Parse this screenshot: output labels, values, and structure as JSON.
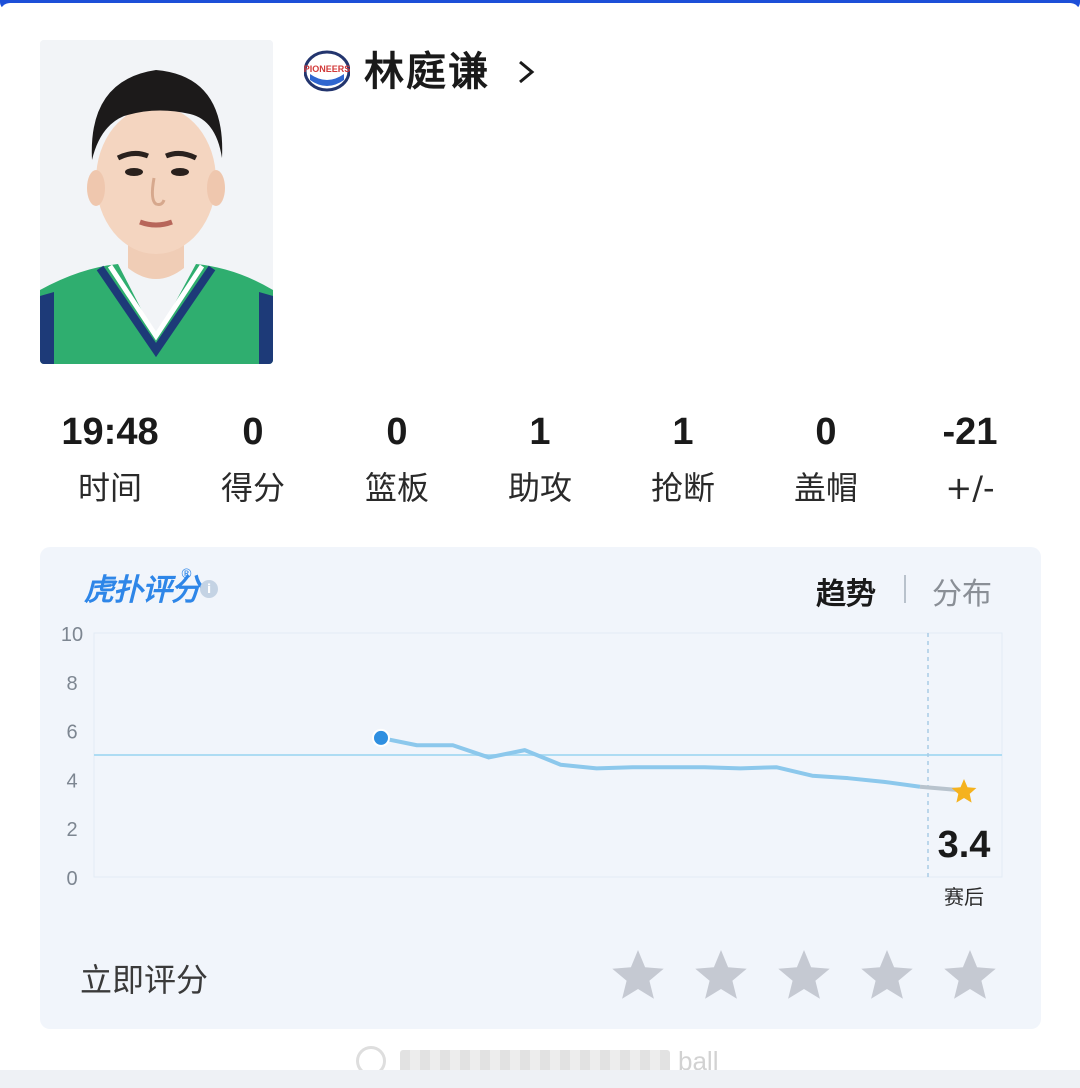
{
  "player": {
    "name": "林庭谦",
    "team_logo_text": "PIONEERS"
  },
  "stats": [
    {
      "value": "19:48",
      "label": "时间"
    },
    {
      "value": "0",
      "label": "得分"
    },
    {
      "value": "0",
      "label": "篮板"
    },
    {
      "value": "1",
      "label": "助攻"
    },
    {
      "value": "1",
      "label": "抢断"
    },
    {
      "value": "0",
      "label": "盖帽"
    },
    {
      "value": "-21",
      "label": "+/-"
    }
  ],
  "rating": {
    "brand": "虎扑评分",
    "brand_mark": "®",
    "info_icon": "i",
    "tabs": {
      "active": "趋势",
      "inactive": "分布"
    },
    "final_score": "3.4",
    "final_label": "赛后",
    "rate_now_label": "立即评分",
    "rate_star_count": 5,
    "colors": {
      "line": "#8cc8ec",
      "start_dot": "#2f8fe0",
      "star": "#f5b21e",
      "empty_star": "#c5c9d2",
      "reference_line": "#aedcf3"
    }
  },
  "chart_data": {
    "type": "line",
    "y_ticks": [
      "10",
      "8",
      "6",
      "4",
      "2",
      "0"
    ],
    "ylim": [
      0,
      10
    ],
    "reference_y": 5,
    "grid": false,
    "series": [
      {
        "values": [
          5.7,
          5.4,
          5.4,
          4.9,
          5.2,
          4.6,
          4.45,
          4.5,
          4.5,
          4.5,
          4.45,
          4.5,
          4.15,
          4.05,
          3.9,
          3.7
        ]
      }
    ],
    "final_value": 3.4,
    "final_label": "赛后"
  },
  "watermark": {
    "text": "ball"
  }
}
